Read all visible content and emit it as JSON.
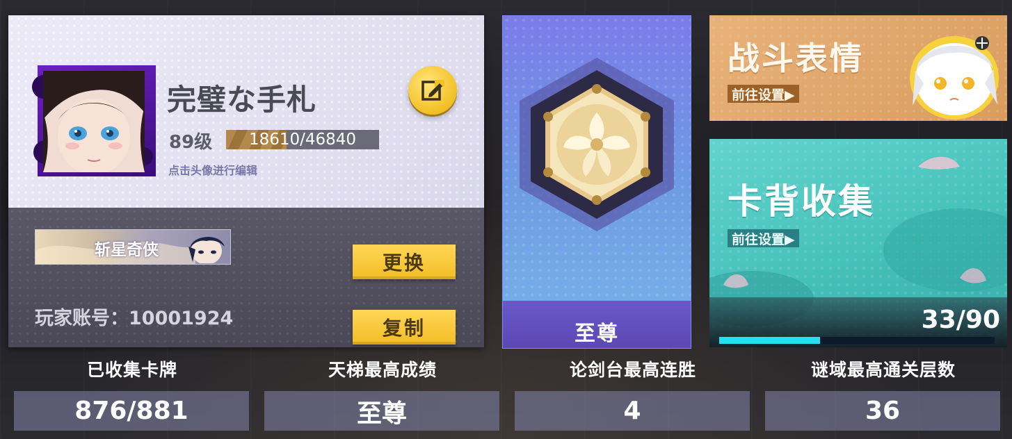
{
  "profile": {
    "name": "完璧な手札",
    "level_label": "89级",
    "xp_text": "18610/46840",
    "xp_fraction": 0.397,
    "avatar_hint": "点击头像进行编辑",
    "edit_icon": "edit-icon",
    "title_badge": "斩星奇侠",
    "change_button": "更换",
    "account_label": "玩家账号：10001924",
    "copy_button": "复制"
  },
  "rank": {
    "label": "至尊"
  },
  "emote_card": {
    "title": "战斗表情",
    "goto": "前往设置▶"
  },
  "cardback_card": {
    "title": "卡背收集",
    "goto": "前往设置▶",
    "count": "33/90",
    "progress_fraction": 0.367
  },
  "stats": [
    {
      "label": "已收集卡牌",
      "value": "876/881"
    },
    {
      "label": "天梯最高成绩",
      "value": "至尊"
    },
    {
      "label": "论剑台最高连胜",
      "value": "4"
    },
    {
      "label": "谜域最高通关层数",
      "value": "36"
    }
  ],
  "colors": {
    "gold_button": "#f3bd25",
    "rank_purple": "#5b48b4",
    "cardback_teal": "#44c1b9",
    "emote_orange": "#d99c5d",
    "progress_cyan": "#27dff0"
  }
}
